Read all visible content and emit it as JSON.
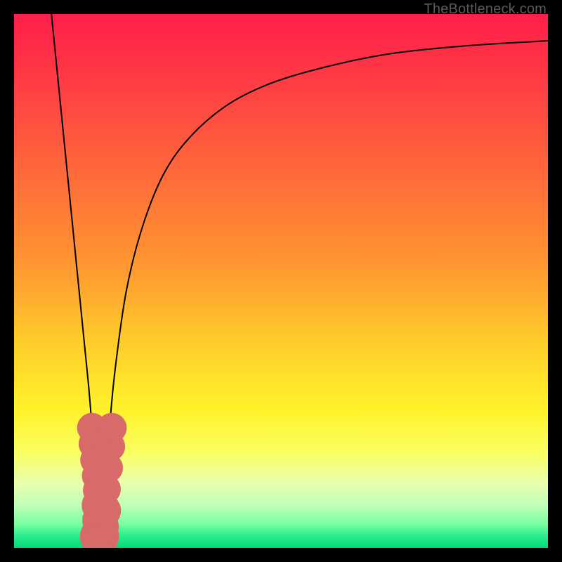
{
  "watermark": "TheBottleneck.com",
  "colors": {
    "frame": "#000000",
    "gradient_stops": [
      {
        "offset": 0.0,
        "color": "#ff1e4a"
      },
      {
        "offset": 0.12,
        "color": "#ff3a44"
      },
      {
        "offset": 0.3,
        "color": "#ff6a3a"
      },
      {
        "offset": 0.48,
        "color": "#ff9a30"
      },
      {
        "offset": 0.62,
        "color": "#ffcf2a"
      },
      {
        "offset": 0.74,
        "color": "#fff22a"
      },
      {
        "offset": 0.82,
        "color": "#faff60"
      },
      {
        "offset": 0.88,
        "color": "#e8ffb0"
      },
      {
        "offset": 0.92,
        "color": "#c0ffb8"
      },
      {
        "offset": 0.955,
        "color": "#7affa0"
      },
      {
        "offset": 0.975,
        "color": "#30f090"
      },
      {
        "offset": 1.0,
        "color": "#00d878"
      }
    ],
    "curve": "#000000",
    "marker_fill": "#d86a6a",
    "marker_stroke": "#c85858"
  },
  "chart_data": {
    "type": "line",
    "title": "",
    "xlabel": "",
    "ylabel": "",
    "xlim": [
      0,
      100
    ],
    "ylim": [
      0,
      100
    ],
    "grid": false,
    "legend": false,
    "annotations": [
      "TheBottleneck.com"
    ],
    "series": [
      {
        "name": "left-branch",
        "x": [
          7.0,
          8.0,
          9.0,
          10.0,
          11.0,
          12.0,
          13.0,
          14.0,
          15.0,
          15.5,
          16.0
        ],
        "y": [
          100,
          90.0,
          80.0,
          70.0,
          60.0,
          50.0,
          40.0,
          30.0,
          18.0,
          10.0,
          2.0
        ]
      },
      {
        "name": "right-branch",
        "x": [
          16.0,
          17.0,
          18.0,
          19.0,
          21.0,
          24.0,
          28.0,
          33.0,
          40.0,
          48.0,
          58.0,
          70.0,
          84.0,
          100.0
        ],
        "y": [
          2.0,
          12.0,
          24.0,
          34.0,
          48.0,
          60.0,
          70.0,
          77.0,
          83.0,
          87.0,
          90.0,
          92.5,
          94.0,
          95.0
        ]
      }
    ],
    "markers": [
      {
        "x": 14.6,
        "y": 22.5,
        "r": 2.0
      },
      {
        "x": 14.9,
        "y": 19.5,
        "r": 2.0
      },
      {
        "x": 15.2,
        "y": 16.5,
        "r": 2.0
      },
      {
        "x": 15.5,
        "y": 13.5,
        "r": 2.0
      },
      {
        "x": 15.7,
        "y": 10.8,
        "r": 2.0
      },
      {
        "x": 15.9,
        "y": 8.0,
        "r": 2.3
      },
      {
        "x": 16.0,
        "y": 5.2,
        "r": 2.3
      },
      {
        "x": 16.0,
        "y": 2.2,
        "r": 2.6
      },
      {
        "x": 16.4,
        "y": 4.0,
        "r": 2.3
      },
      {
        "x": 16.8,
        "y": 7.0,
        "r": 2.3
      },
      {
        "x": 17.2,
        "y": 11.0,
        "r": 2.0
      },
      {
        "x": 17.6,
        "y": 15.0,
        "r": 2.0
      },
      {
        "x": 18.0,
        "y": 19.0,
        "r": 2.0
      },
      {
        "x": 18.3,
        "y": 22.5,
        "r": 2.0
      }
    ]
  }
}
